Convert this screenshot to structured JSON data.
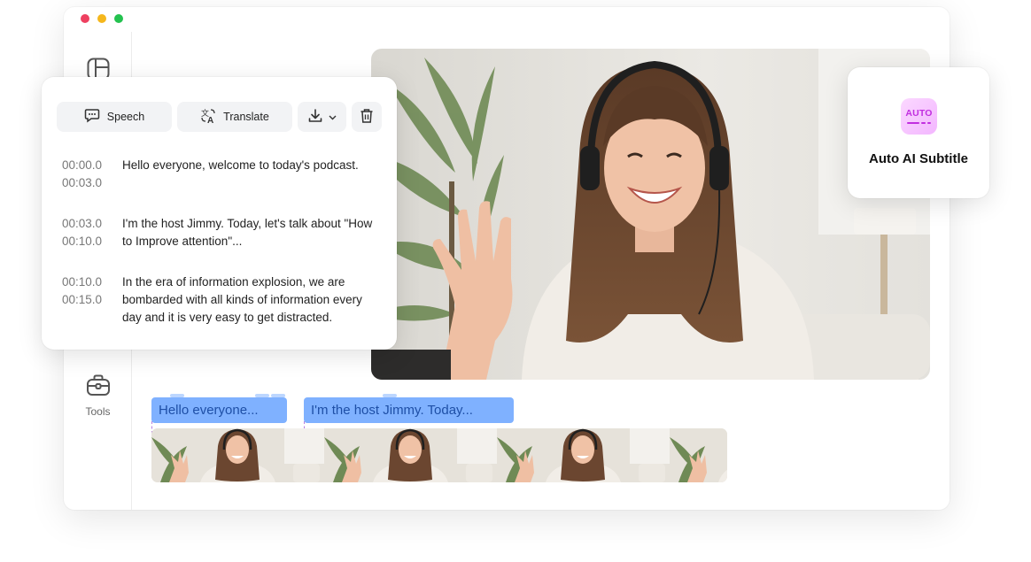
{
  "toolbar": {
    "speech_label": "Speech",
    "translate_label": "Translate"
  },
  "sidebar": {
    "tools_label": "Tools"
  },
  "subtitles": [
    {
      "start": "00:00.0",
      "end": "00:03.0",
      "text": "Hello everyone, welcome to today's podcast."
    },
    {
      "start": "00:03.0",
      "end": "00:10.0",
      "text": "I'm the host Jimmy. Today, let's talk about \"How to Improve attention\"..."
    },
    {
      "start": "00:10.0",
      "end": "00:15.0",
      "text": "In the era of information explosion, we are bombarded with all kinds of information every day and it is very easy to get distracted."
    }
  ],
  "feature_card": {
    "badge_text": "AUTO",
    "title": "Auto AI Subtitle"
  },
  "timeline": {
    "chips": [
      "Hello everyone...",
      "I'm the host Jimmy. Today..."
    ]
  },
  "colors": {
    "chip_bg": "#7fb1ff",
    "chip_text": "#1e4fa6",
    "badge_accent": "#c12ee0"
  }
}
